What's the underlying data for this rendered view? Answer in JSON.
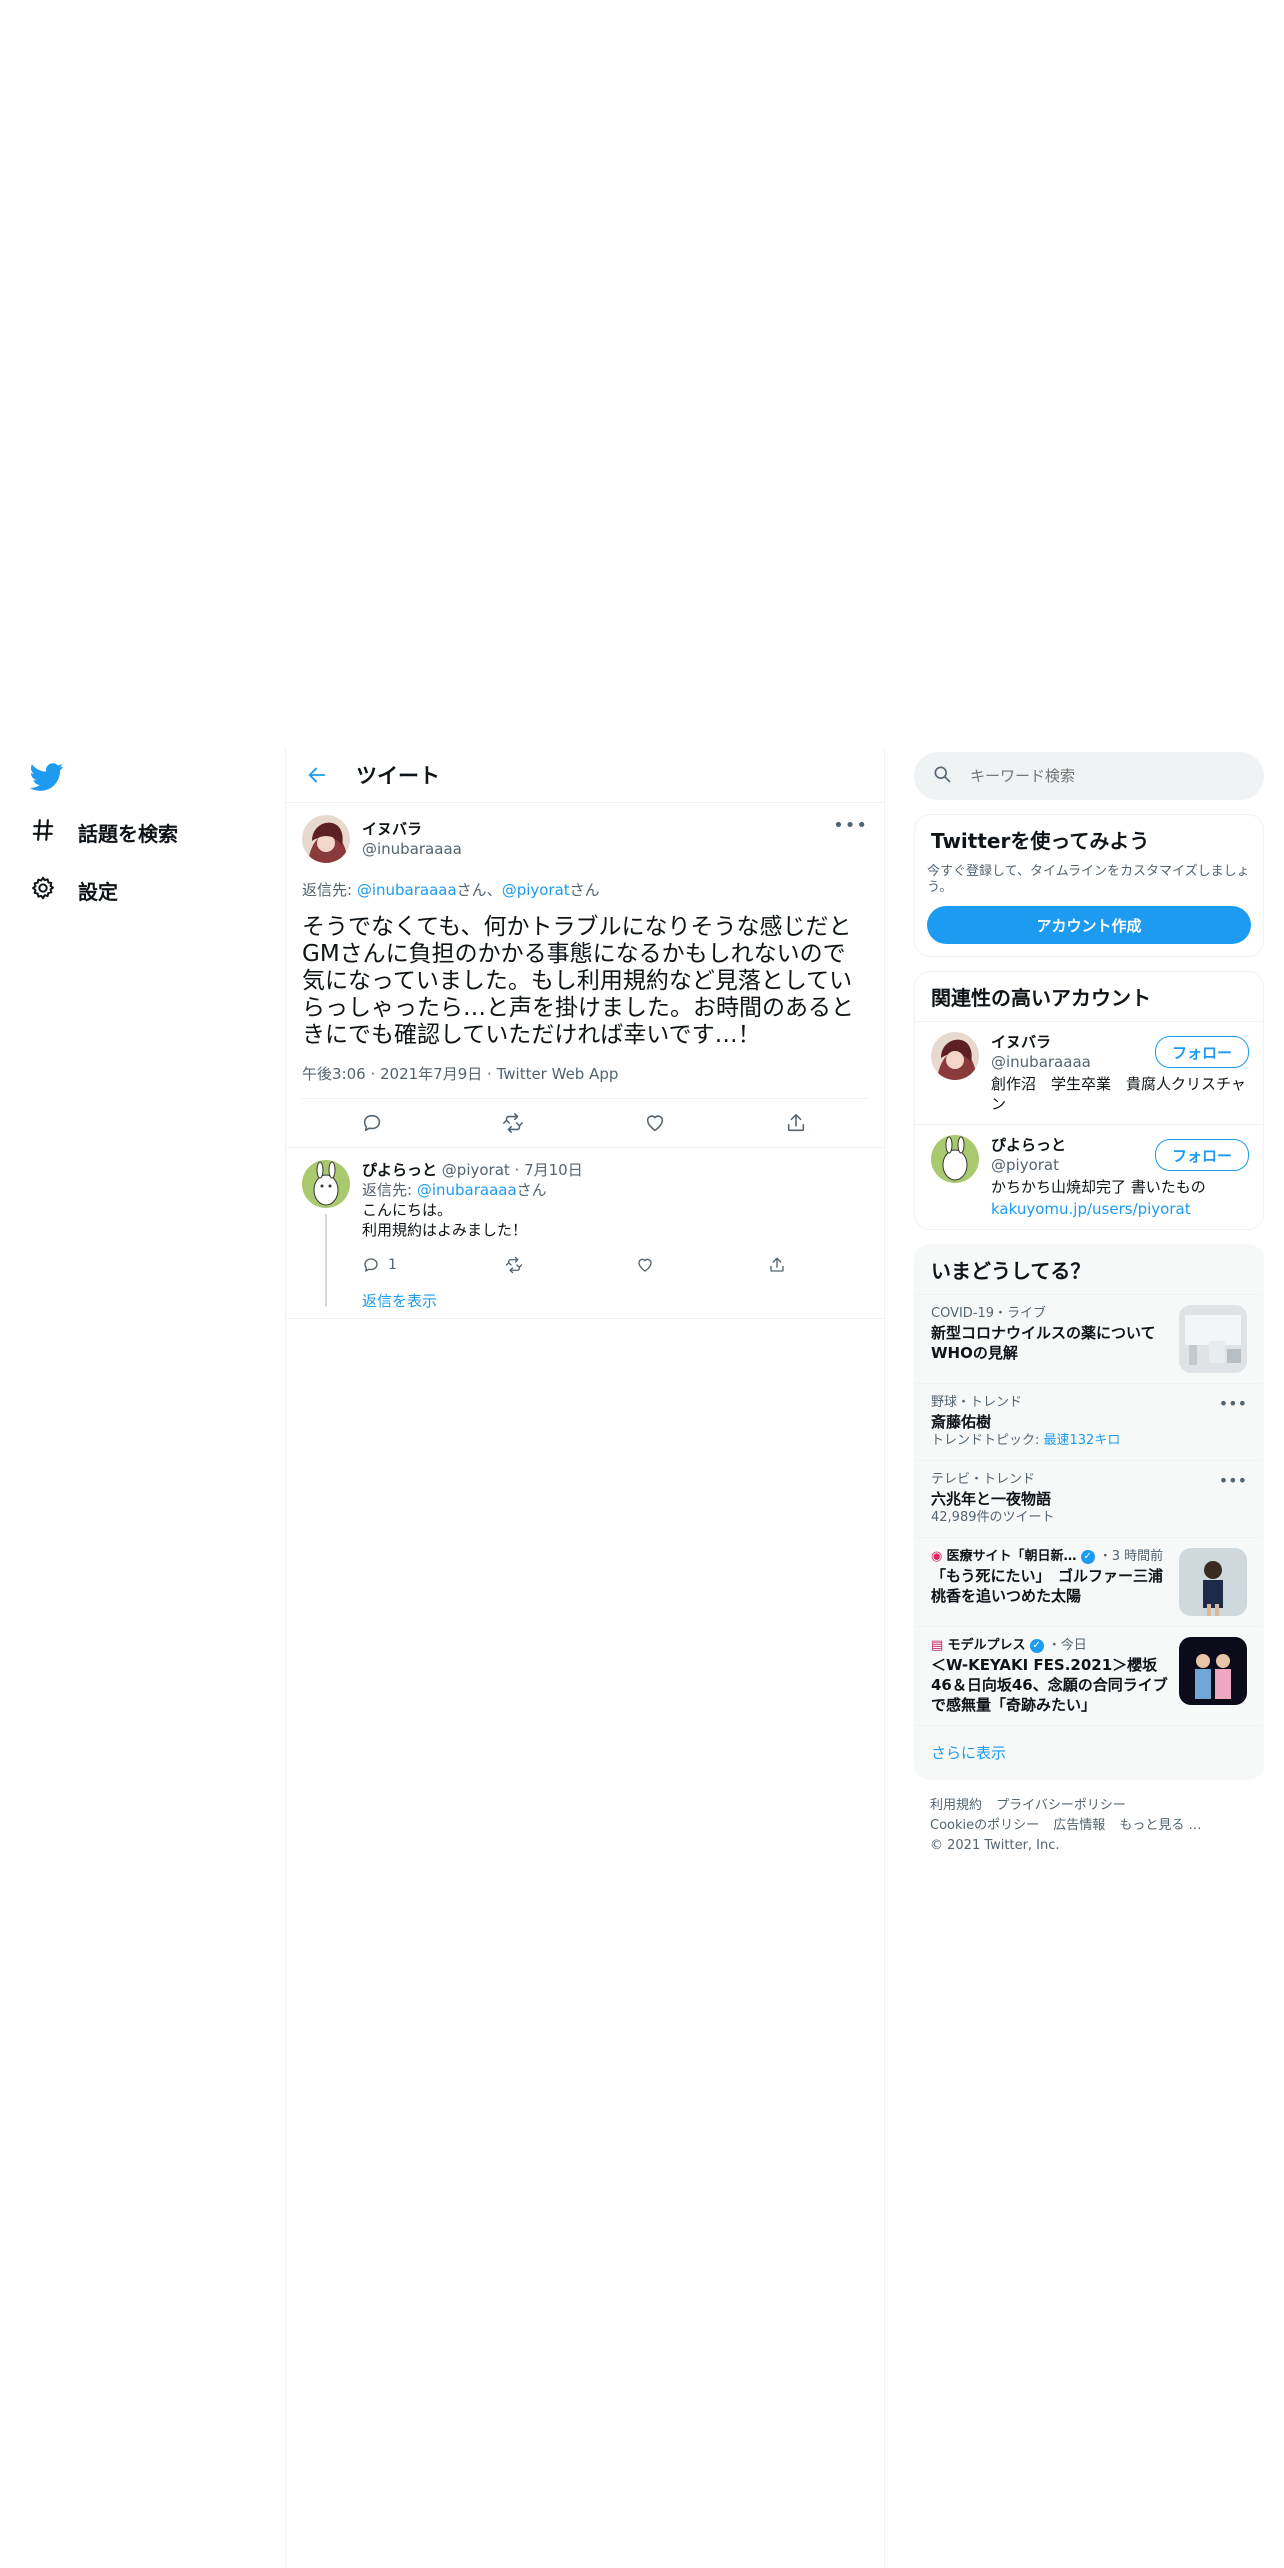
{
  "nav": {
    "explore_label": "話題を検索",
    "settings_label": "設定"
  },
  "main": {
    "title": "ツイート"
  },
  "tweet": {
    "name": "イヌバラ",
    "handle": "@inubaraaaa",
    "reply_prefix": "返信先: ",
    "reply_user1": "@inubaraaaa",
    "reply_sep": "さん、",
    "reply_user2": "@piyorat",
    "reply_suffix": "さん",
    "text": "そうでなくても、何かトラブルになりそうな感じだとGMさんに負担のかかる事態になるかもしれないので気になっていました。もし利用規約など見落としていらっしゃったら…と声を掛けました。お時間のあるときにでも確認していただければ幸いです…！",
    "time": "午後3:06",
    "date": "2021年7月9日",
    "source": "Twitter Web App"
  },
  "reply": {
    "name": "ぴよらっと",
    "handle": "@piyorat",
    "date": "7月10日",
    "reply_prefix": "返信先: ",
    "reply_user": "@inubaraaaa",
    "reply_suffix": "さん",
    "line1": "こんにちは。",
    "line2": "利用規約はよみました！",
    "reply_count": "1",
    "show_replies": "返信を表示"
  },
  "sidebar": {
    "search_placeholder": "キーワード検索",
    "signup": {
      "title": "Twitterを使ってみよう",
      "desc": "今すぐ登録して、タイムラインをカスタマイズしましょう。",
      "button": "アカウント作成"
    },
    "related": {
      "title": "関連性の高いアカウント",
      "accounts": [
        {
          "name": "イヌバラ",
          "handle": "@inubaraaaa",
          "bio": "創作沼　学生卒業　貴腐人クリスチャン",
          "link": "",
          "follow": "フォロー"
        },
        {
          "name": "ぴよらっと",
          "handle": "@piyorat",
          "bio": "かちかち山焼却完了 書いたもの",
          "link": "kakuyomu.jp/users/piyorat",
          "follow": "フォロー"
        }
      ]
    },
    "trends": {
      "title": "いまどうしてる？",
      "items": [
        {
          "meta": "COVID-19・ライブ",
          "title": "新型コロナウイルスの薬について\nWHOの見解",
          "sub": ""
        },
        {
          "meta": "野球・トレンド",
          "title": "斎藤佑樹",
          "sub_prefix": "トレンドトピック: ",
          "sub_link": "最速132キロ"
        },
        {
          "meta": "テレビ・トレンド",
          "title": "六兆年と一夜物語",
          "sub": "42,989件のツイート"
        },
        {
          "meta_source": "医療サイト「朝日新…",
          "meta_time": "・3 時間前",
          "title": "「もう死にたい」　ゴルファー三浦桃香を追いつめた太陽"
        },
        {
          "meta_source": "モデルプレス",
          "meta_time": "・今日",
          "title": "＜W-KEYAKI FES.2021＞櫻坂46＆日向坂46、念願の合同ライブで感無量「奇跡みたい」"
        }
      ],
      "show_more": "さらに表示"
    },
    "footer": {
      "terms": "利用規約",
      "privacy": "プライバシーポリシー",
      "cookie": "Cookieのポリシー",
      "ads": "広告情報",
      "more": "もっと見る …",
      "copyright": "© 2021 Twitter, Inc."
    }
  },
  "colors": {
    "accent": "#1d9bf0",
    "text": "#0f1419",
    "muted": "#536471",
    "border": "#eff3f4"
  }
}
